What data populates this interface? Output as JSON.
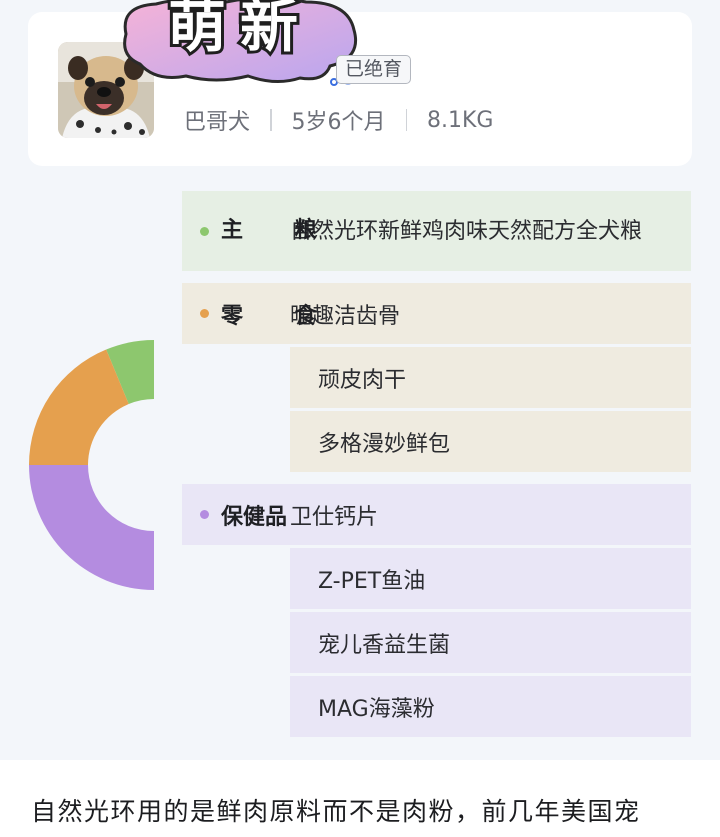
{
  "pet": {
    "name": "萌新",
    "neutered_badge": "已绝育",
    "breed": "巴哥犬",
    "age": "5岁6个月",
    "weight": "8.1KG"
  },
  "diet": {
    "categories": [
      {
        "label": "主 粮",
        "color": "#8dc76e",
        "items": [
          "自然光环新鲜鸡肉味天然配方全犬粮"
        ]
      },
      {
        "label": "零 食",
        "color": "#e5a04e",
        "items": [
          "昵趣洁齿骨",
          "顽皮肉干",
          "多格漫妙鲜包"
        ]
      },
      {
        "label": "保健品",
        "color": "#b48ce0",
        "items": [
          "卫仕钙片",
          "Z-PET鱼油",
          "宠儿香益生菌",
          "MAG海藻粉"
        ]
      }
    ]
  },
  "chart_data": {
    "type": "pie",
    "series": [
      {
        "category": "主 粮",
        "value": 1,
        "color": "#8dc76e"
      },
      {
        "category": "零 食",
        "value": 3,
        "color": "#e5a04e"
      },
      {
        "category": "保健品",
        "value": 4,
        "color": "#b48ce0"
      }
    ]
  },
  "article": {
    "text": "自然光环用的是鲜肉原料而不是肉粉，前几年美国宠"
  }
}
